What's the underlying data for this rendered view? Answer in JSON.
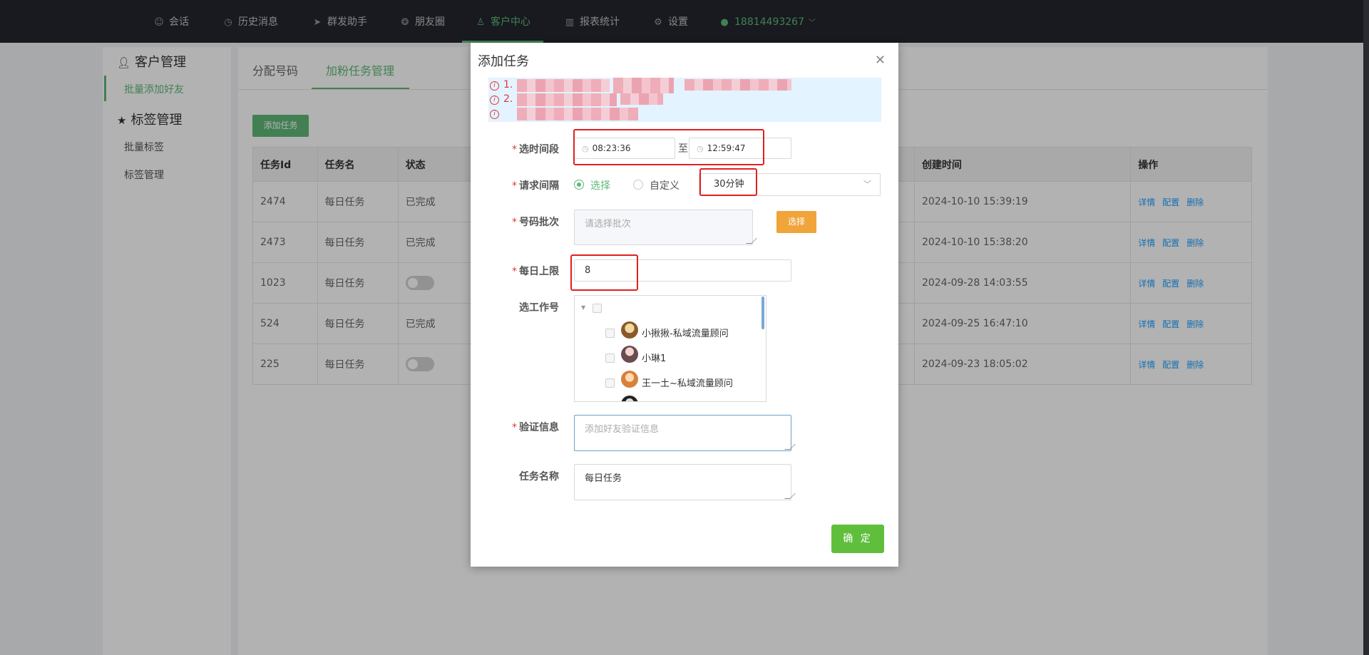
{
  "nav": {
    "items": [
      {
        "label": "会话",
        "icon": "chat-icon"
      },
      {
        "label": "历史消息",
        "icon": "clock-icon"
      },
      {
        "label": "群发助手",
        "icon": "send-icon"
      },
      {
        "label": "朋友圈",
        "icon": "aperture-icon"
      },
      {
        "label": "客户中心",
        "icon": "user-icon"
      },
      {
        "label": "报表统计",
        "icon": "bar-chart-icon"
      },
      {
        "label": "设置",
        "icon": "gear-icon"
      }
    ],
    "user": "18814493267",
    "active_color": "#5fb878"
  },
  "sidebar": {
    "group1": "客户管理",
    "group1_items": [
      "批量添加好友"
    ],
    "group2": "标签管理",
    "group2_items": [
      "批量标签",
      "标签管理"
    ]
  },
  "main": {
    "tabs": [
      "分配号码",
      "加粉任务管理"
    ],
    "add_button": "添加任务",
    "columns": [
      "任务Id",
      "任务名",
      "状态",
      "创建时间",
      "操作"
    ],
    "rows": [
      {
        "id": "2474",
        "name": "每日任务",
        "status": "已完成",
        "created": "2024-10-10 15:39:19"
      },
      {
        "id": "2473",
        "name": "每日任务",
        "status": "已完成",
        "created": "2024-10-10 15:38:20"
      },
      {
        "id": "1023",
        "name": "每日任务",
        "status": "",
        "created": "2024-09-28 14:03:55"
      },
      {
        "id": "524",
        "name": "每日任务",
        "status": "已完成",
        "created": "2024-09-25 16:47:10"
      },
      {
        "id": "225",
        "name": "每日任务",
        "status": "",
        "created": "2024-09-23 18:05:02"
      }
    ],
    "ops": [
      "详情",
      "配置",
      "删除"
    ]
  },
  "modal": {
    "title": "添加任务",
    "notices": [
      "1.",
      "2.",
      ""
    ],
    "time_label": "选时间段",
    "time_start": "08:23:36",
    "time_sep": "至",
    "time_end": "12:59:47",
    "interval_label": "请求间隔",
    "radio_select": "选择",
    "radio_custom": "自定义",
    "interval_value": "30分钟",
    "batch_label": "号码批次",
    "batch_placeholder": "请选择批次",
    "batch_button": "选择",
    "daily_label": "每日上限",
    "daily_value": "8",
    "worker_label": "选工作号",
    "workers": [
      "小揪揪-私域流量顾问",
      "小琳1",
      "王一土~私域流量顾问"
    ],
    "verify_label": "验证信息",
    "verify_placeholder": "添加好友验证信息",
    "taskname_label": "任务名称",
    "taskname_value": "每日任务",
    "confirm": "确 定"
  }
}
